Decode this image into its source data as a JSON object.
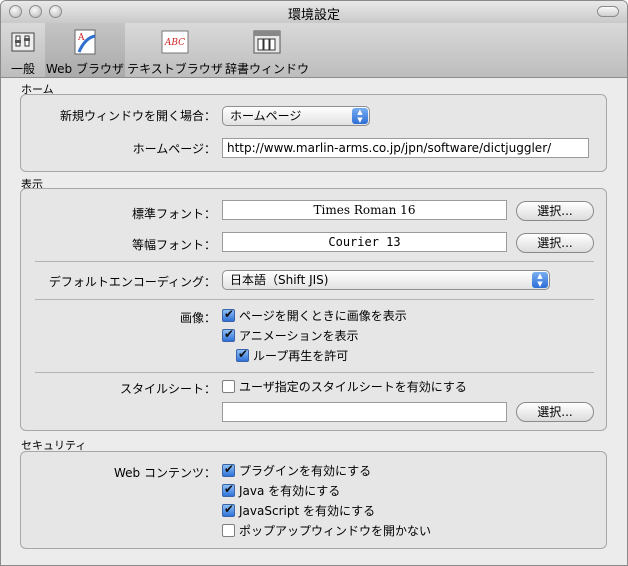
{
  "window": {
    "title": "環境設定"
  },
  "toolbar": [
    {
      "label": "一般",
      "icon": "general-prefs-icon"
    },
    {
      "label": "Web ブラウザ",
      "icon": "web-browser-icon",
      "selected": true
    },
    {
      "label": "テキストブラウザ",
      "icon": "text-browser-icon",
      "icon_text": "ABC"
    },
    {
      "label": "辞書ウィンドウ",
      "icon": "dictionary-window-icon"
    }
  ],
  "home": {
    "section_title": "ホーム",
    "new_window_label": "新規ウィンドウを開く場合：",
    "new_window_value": "ホームページ",
    "homepage_label": "ホームページ：",
    "homepage_url": "http://www.marlin-arms.co.jp/jpn/software/dictjuggler/"
  },
  "display": {
    "section_title": "表示",
    "standard_font_label": "標準フォント：",
    "standard_font_value": "Times Roman 16",
    "monospace_font_label": "等幅フォント：",
    "monospace_font_value": "Courier 13",
    "select_label": "選択...",
    "encoding_label": "デフォルトエンコーディング：",
    "encoding_value": "日本語（Shift JIS)",
    "images_label": "画像：",
    "show_images_label": "ページを開くときに画像を表示",
    "show_images_checked": true,
    "show_animation_label": "アニメーションを表示",
    "show_animation_checked": true,
    "allow_loop_label": "ループ再生を許可",
    "allow_loop_checked": true,
    "stylesheet_label": "スタイルシート：",
    "user_stylesheet_label": "ユーザ指定のスタイルシートを有効にする",
    "user_stylesheet_checked": false,
    "stylesheet_path": ""
  },
  "security": {
    "section_title": "セキュリティ",
    "web_content_label": "Web コンテンツ：",
    "plugins_label": "プラグインを有効にする",
    "plugins_checked": true,
    "java_label": "Java を有効にする",
    "java_checked": true,
    "javascript_label": "JavaScript を有効にする",
    "javascript_checked": true,
    "block_popups_label": "ポップアップウィンドウを開かない",
    "block_popups_checked": false
  }
}
